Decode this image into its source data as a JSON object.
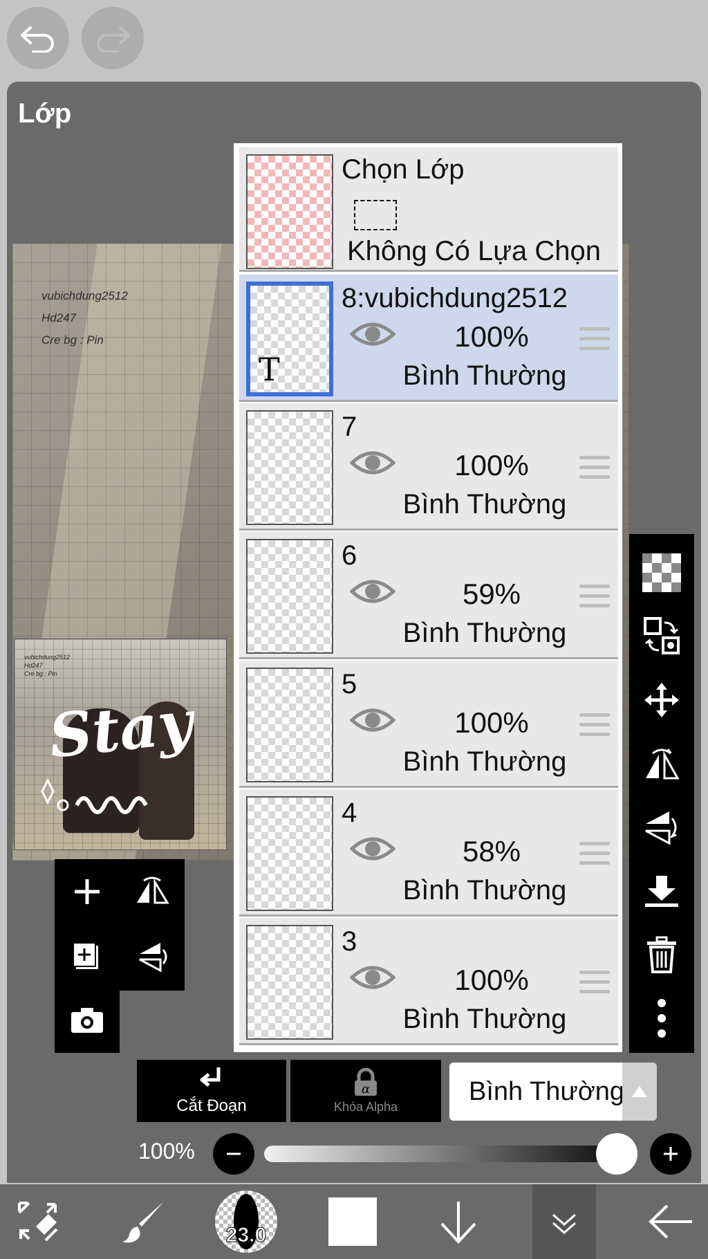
{
  "panel": {
    "title": "Lớp"
  },
  "canvas": {
    "credit_lines": [
      "vubichdung2512",
      "Hd247",
      "Cre bg : Pin"
    ],
    "thumb_credit_lines": [
      "vubichdung2512",
      "Hd247",
      "Cre bg : Pin"
    ],
    "thumb_text": "Stay"
  },
  "selection_layer": {
    "title": "Chọn Lớp",
    "subtitle": "Không Có Lựa Chọn"
  },
  "layers": [
    {
      "name": "8:vubichdung2512",
      "opacity": "100%",
      "blend": "Bình Thường",
      "selected": true,
      "thumb_glyph": "T"
    },
    {
      "name": "7",
      "opacity": "100%",
      "blend": "Bình Thường",
      "selected": false,
      "thumb_glyph": ""
    },
    {
      "name": "6",
      "opacity": "59%",
      "blend": "Bình Thường",
      "selected": false,
      "thumb_glyph": ""
    },
    {
      "name": "5",
      "opacity": "100%",
      "blend": "Bình Thường",
      "selected": false,
      "thumb_glyph": ""
    },
    {
      "name": "4",
      "opacity": "58%",
      "blend": "Bình Thường",
      "selected": false,
      "thumb_glyph": ""
    },
    {
      "name": "3",
      "opacity": "100%",
      "blend": "Bình Thường",
      "selected": false,
      "thumb_glyph": ""
    }
  ],
  "bottom_controls": {
    "clip_label": "Cắt Đoạn",
    "alpha_lock_label": "Khóa Alpha",
    "blend_mode": "Bình Thường",
    "opacity_label": "100%",
    "opacity_value": 1.0
  },
  "toolbar": {
    "brush_size": "23.0"
  },
  "colors": {
    "selected_row": "#cfd7ec",
    "selected_border": "#3d6fd8",
    "panel_bg": "#6a6a6a"
  }
}
